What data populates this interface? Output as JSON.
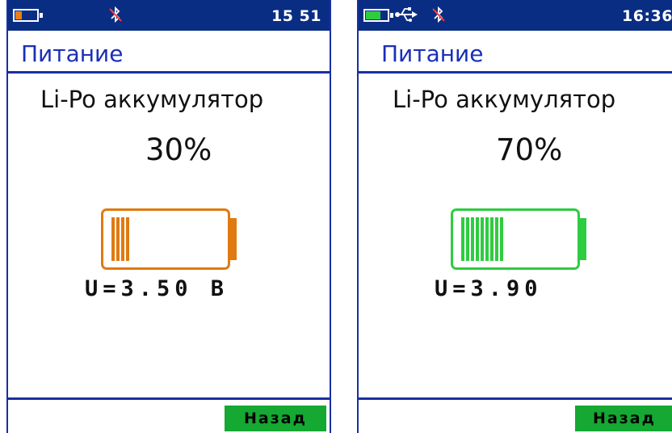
{
  "screens": [
    {
      "status": {
        "time": "15 51",
        "battery_level": 0.3,
        "battery_color": "#e8801a",
        "usb_connected": false,
        "bluetooth_icon": "bluetooth-off-icon"
      },
      "title": "Питание",
      "battery_type": "Li-Po аккумулятор",
      "percent": "30%",
      "charge_level": 0.3,
      "accent_color": "#e07a10",
      "voltage": "U=3.50 В",
      "back_button": "Назад"
    },
    {
      "status": {
        "time": "16:36",
        "battery_level": 0.7,
        "battery_color": "#2ecc40",
        "usb_connected": true,
        "usb_icon": "usb-icon",
        "bluetooth_icon": "bluetooth-off-icon"
      },
      "title": "Питание",
      "battery_type": "Li-Po аккумулятор",
      "percent": "70%",
      "charge_level": 0.7,
      "accent_color": "#2ecc40",
      "voltage": "U=3.90",
      "back_button": "Назад"
    }
  ]
}
